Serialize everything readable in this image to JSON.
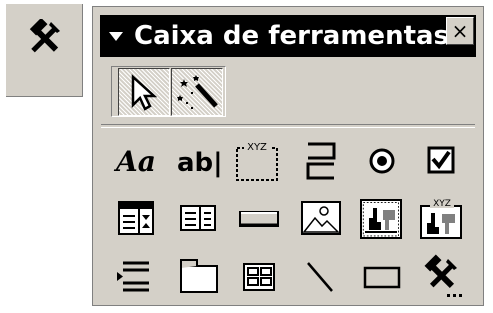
{
  "window": {
    "title": "Caixa de ferramentas",
    "close_glyph": "×",
    "menu_glyph": "▼"
  },
  "external_button": {
    "icon": "toolbox-icon"
  },
  "selection_tools": [
    {
      "name": "select-objects",
      "icon": "arrow-pointer-icon",
      "pressed": true
    },
    {
      "name": "control-wizards",
      "icon": "magic-wand-icon",
      "pressed": true
    }
  ],
  "controls": {
    "label_glyph": "Aa",
    "textbox_glyph": "ab|",
    "option_group_caption": "XYZ",
    "bound_frame_caption": "XYZ"
  },
  "colors": {
    "face": "#d4d0c8",
    "shadow": "#808080",
    "title": "#000000",
    "title_text": "#ffffff"
  }
}
